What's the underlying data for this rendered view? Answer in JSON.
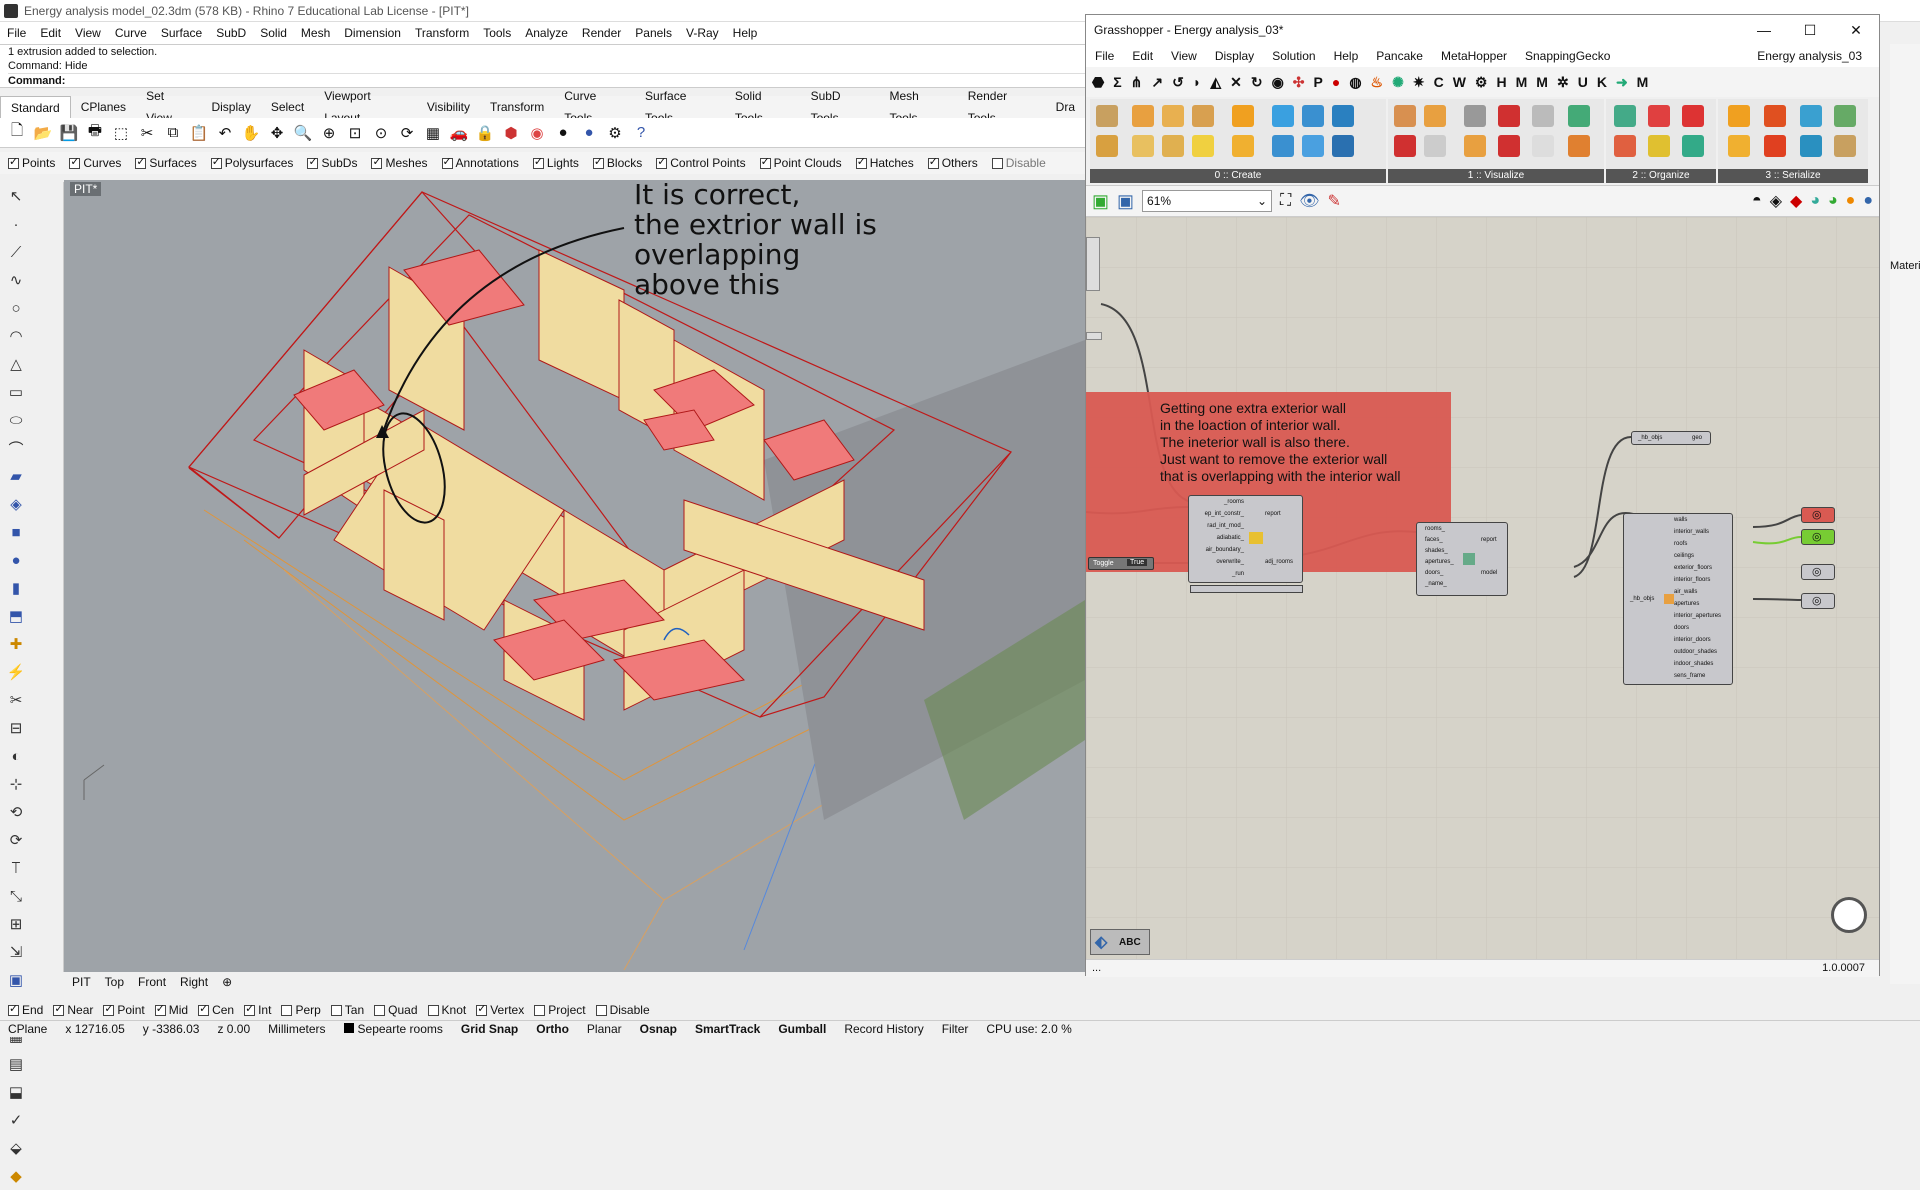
{
  "rhino": {
    "title": "Energy analysis model_02.3dm (578 KB) - Rhino 7 Educational Lab License - [PIT*]",
    "menu": [
      "File",
      "Edit",
      "View",
      "Curve",
      "Surface",
      "SubD",
      "Solid",
      "Mesh",
      "Dimension",
      "Transform",
      "Tools",
      "Analyze",
      "Render",
      "Panels",
      "V-Ray",
      "Help"
    ],
    "cmd_history": "1 extrusion added to selection.",
    "cmd_last": "Command: Hide",
    "cmd_prompt": "Command:",
    "toolbar_tabs": [
      "Standard",
      "CPlanes",
      "Set View",
      "Display",
      "Select",
      "Viewport Layout",
      "Visibility",
      "Transform",
      "Curve Tools",
      "Surface Tools",
      "Solid Tools",
      "SubD Tools",
      "Mesh Tools",
      "Render Tools",
      "Dra"
    ],
    "filters": [
      {
        "label": "Points",
        "on": true
      },
      {
        "label": "Curves",
        "on": true
      },
      {
        "label": "Surfaces",
        "on": true
      },
      {
        "label": "Polysurfaces",
        "on": true
      },
      {
        "label": "SubDs",
        "on": true
      },
      {
        "label": "Meshes",
        "on": true
      },
      {
        "label": "Annotations",
        "on": true
      },
      {
        "label": "Lights",
        "on": true
      },
      {
        "label": "Blocks",
        "on": true
      },
      {
        "label": "Control Points",
        "on": true
      },
      {
        "label": "Point Clouds",
        "on": true
      },
      {
        "label": "Hatches",
        "on": true
      },
      {
        "label": "Others",
        "on": true
      },
      {
        "label": "Disable",
        "on": false
      }
    ],
    "viewport_label": "PIT*",
    "annotation_lines": [
      "It is correct,",
      "the extrior wall is",
      "overlapping",
      "above this"
    ],
    "view_tabs": [
      "PIT",
      "Top",
      "Front",
      "Right"
    ],
    "osnaps": [
      {
        "label": "End",
        "on": true
      },
      {
        "label": "Near",
        "on": true
      },
      {
        "label": "Point",
        "on": true
      },
      {
        "label": "Mid",
        "on": true
      },
      {
        "label": "Cen",
        "on": true
      },
      {
        "label": "Int",
        "on": true
      },
      {
        "label": "Perp",
        "on": false
      },
      {
        "label": "Tan",
        "on": false
      },
      {
        "label": "Quad",
        "on": false
      },
      {
        "label": "Knot",
        "on": false
      },
      {
        "label": "Vertex",
        "on": true
      },
      {
        "label": "Project",
        "on": false
      },
      {
        "label": "Disable",
        "on": false
      }
    ],
    "status": {
      "cplane": "CPlane",
      "x": "x 12716.05",
      "y": "y -3386.03",
      "z": "z 0.00",
      "units": "Millimeters",
      "layer": "Sepearte rooms",
      "toggles": [
        "Grid Snap",
        "Ortho",
        "Planar",
        "Osnap",
        "SmartTrack",
        "Gumball",
        "Record History",
        "Filter"
      ],
      "cpu": "CPU use: 2.0 %"
    },
    "right_panel_label": "Materia"
  },
  "gh": {
    "title": "Grasshopper - Energy analysis_03*",
    "menu": [
      "File",
      "Edit",
      "View",
      "Display",
      "Solution",
      "Help",
      "Pancake",
      "MetaHopper",
      "SnappingGecko"
    ],
    "doc_name": "Energy analysis_03",
    "cat_letters": [
      "P",
      "C",
      "W",
      "H",
      "M",
      "M",
      "U",
      "K",
      "M"
    ],
    "ribbon_groups": [
      "0 :: Create",
      "1 :: Visualize",
      "2 :: Organize",
      "3 :: Serialize"
    ],
    "zoom": "61%",
    "note_lines": [
      "Getting one extra exterior wall",
      "in the loaction of interior wall.",
      "The ineterior wall is also there.",
      "Just want to remove the exterior wall",
      "that is overlapping with the interior wall"
    ],
    "comp1_inputs": [
      "_rooms",
      "ep_int_constr_",
      "rad_int_mod_",
      "adiabatic_",
      "air_boundary_",
      "overwrite_",
      "_run"
    ],
    "comp1_outputs": [
      "report",
      "adj_rooms"
    ],
    "toggle_label": "Toggle",
    "toggle_value": "True",
    "comp2_inputs": [
      "rooms_",
      "faces_",
      "shades_",
      "apertures_",
      "doors_",
      "_name_"
    ],
    "comp2_outputs": [
      "report",
      "model"
    ],
    "comp3_input": "_hb_objs",
    "comp3_outputs": [
      "walls",
      "interior_walls",
      "roofs",
      "ceilings",
      "exterior_floors",
      "interior_floors",
      "air_walls",
      "apertures",
      "interior_apertures",
      "doors",
      "interior_doors",
      "outdoor_shades",
      "indoor_shades",
      "sens_frame"
    ],
    "comp4_in": "_hb_objs",
    "comp4_out": "geo",
    "version": "1.0.0007",
    "status_dots": "..."
  }
}
